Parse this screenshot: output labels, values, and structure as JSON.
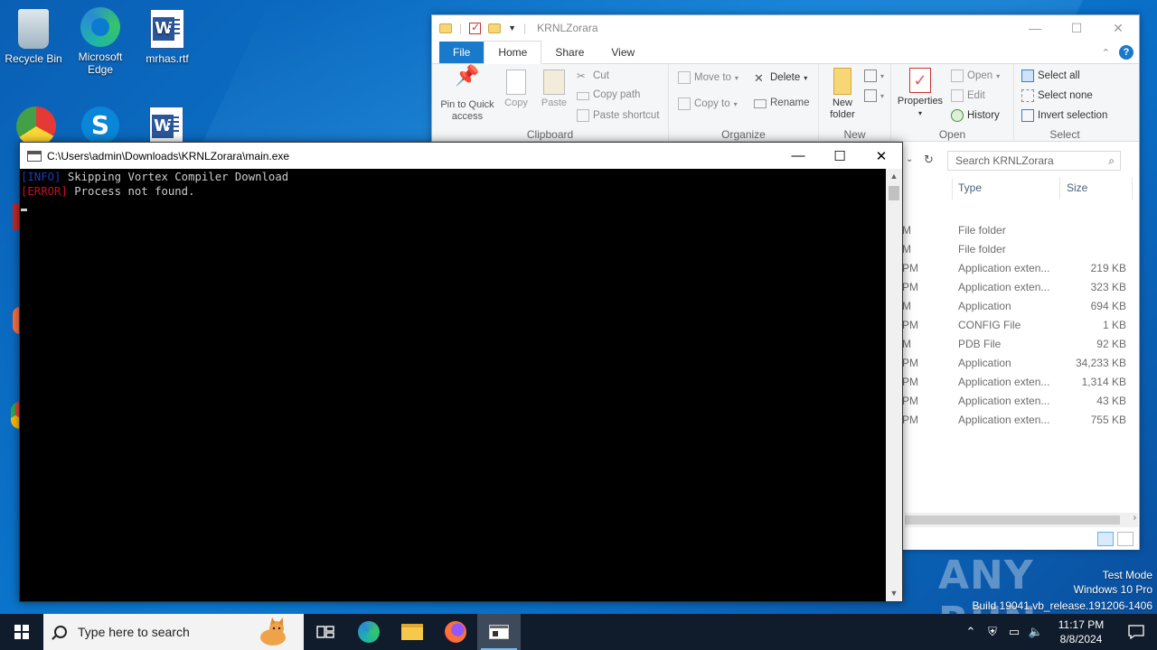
{
  "desktop": {
    "icons": [
      {
        "label": "Recycle Bin"
      },
      {
        "label": "Microsoft Edge"
      },
      {
        "label": "mrhas.rtf"
      }
    ]
  },
  "explorer": {
    "title": "KRNLZorara",
    "tabs": {
      "file": "File",
      "home": "Home",
      "share": "Share",
      "view": "View"
    },
    "clipboard": {
      "pin": "Pin to Quick access",
      "copy": "Copy",
      "paste": "Paste",
      "cut": "Cut",
      "copy_path": "Copy path",
      "paste_shortcut": "Paste shortcut",
      "label": "Clipboard"
    },
    "organize": {
      "move_to": "Move to",
      "copy_to": "Copy to",
      "delete": "Delete",
      "rename": "Rename",
      "label": "Organize"
    },
    "new": {
      "new_folder": "New folder",
      "label": "New"
    },
    "open": {
      "properties": "Properties",
      "open": "Open",
      "edit": "Edit",
      "history": "History",
      "label": "Open"
    },
    "select": {
      "select_all": "Select all",
      "select_none": "Select none",
      "invert": "Invert selection",
      "label": "Select"
    },
    "search_placeholder": "Search KRNLZorara",
    "columns": {
      "type": "Type",
      "size": "Size"
    },
    "rows": [
      {
        "date": "M",
        "type": "File folder",
        "size": ""
      },
      {
        "date": "M",
        "type": "File folder",
        "size": ""
      },
      {
        "date": "PM",
        "type": "Application exten...",
        "size": "219 KB"
      },
      {
        "date": "PM",
        "type": "Application exten...",
        "size": "323 KB"
      },
      {
        "date": "M",
        "type": "Application",
        "size": "694 KB"
      },
      {
        "date": "PM",
        "type": "CONFIG File",
        "size": "1 KB"
      },
      {
        "date": "M",
        "type": "PDB File",
        "size": "92 KB"
      },
      {
        "date": "PM",
        "type": "Application",
        "size": "34,233 KB"
      },
      {
        "date": "PM",
        "type": "Application exten...",
        "size": "1,314 KB"
      },
      {
        "date": "PM",
        "type": "Application exten...",
        "size": "43 KB"
      },
      {
        "date": "PM",
        "type": "Application exten...",
        "size": "755 KB"
      }
    ]
  },
  "console": {
    "title": "C:\\Users\\admin\\Downloads\\KRNLZorara\\main.exe",
    "lines": [
      {
        "tag": "[INFO]",
        "text": " Skipping Vortex Compiler Download"
      },
      {
        "tag": "[ERROR]",
        "text": " Process not found."
      }
    ]
  },
  "watermark": {
    "brand": "ANY RUN",
    "mode": "Test Mode",
    "os": "Windows 10 Pro",
    "build": "Build 19041.vb_release.191206-1406"
  },
  "taskbar": {
    "search_placeholder": "Type here to search",
    "time": "11:17 PM",
    "date": "8/8/2024"
  },
  "colors": {
    "accent": "#1979ca",
    "desktop": "#0b7ad1",
    "taskbar": "#101b2b",
    "info_tag": "#1e3ab8",
    "error_tag": "#c50f1f"
  }
}
